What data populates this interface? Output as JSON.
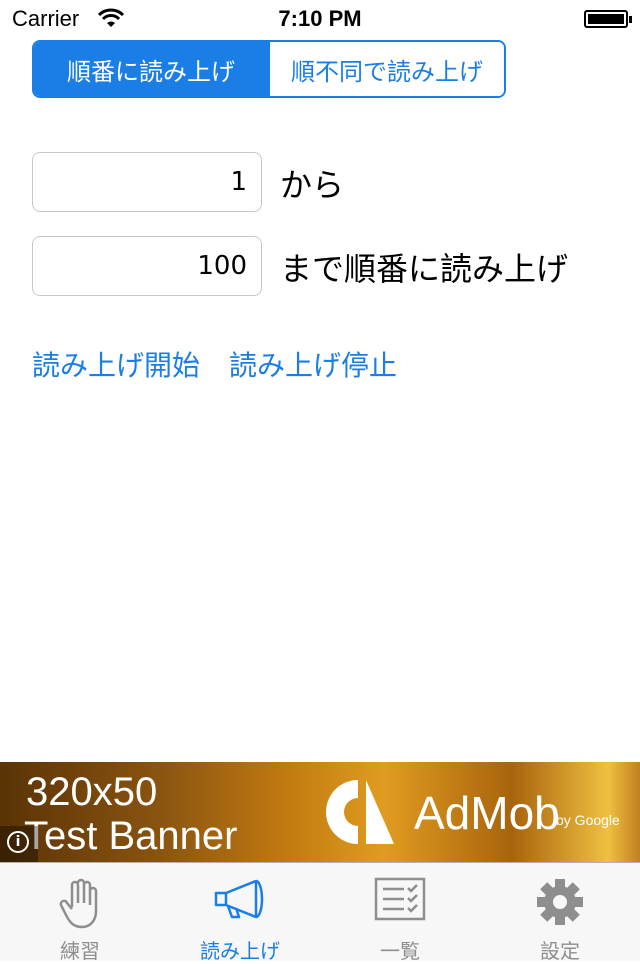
{
  "status_bar": {
    "carrier": "Carrier",
    "time": "7:10 PM"
  },
  "segment": {
    "items": [
      "順番に読み上げ",
      "順不同で読み上げ"
    ],
    "selected": 0
  },
  "range": {
    "from_value": "1",
    "from_label": "から",
    "to_value": "100",
    "to_label": "まで順番に読み上げ"
  },
  "actions": {
    "start": "読み上げ開始",
    "stop": "読み上げ停止"
  },
  "ad": {
    "line1": "320x50",
    "line2": "Test Banner",
    "brand": "AdMob",
    "by": "by Google"
  },
  "tabs": [
    {
      "label": "練習",
      "icon": "hand-icon"
    },
    {
      "label": "読み上げ",
      "icon": "megaphone-icon",
      "active": true
    },
    {
      "label": "一覧",
      "icon": "checklist-icon"
    },
    {
      "label": "設定",
      "icon": "gear-icon"
    }
  ],
  "colors": {
    "accent": "#1a7ee6",
    "tab_inactive": "#8e8e8e"
  }
}
